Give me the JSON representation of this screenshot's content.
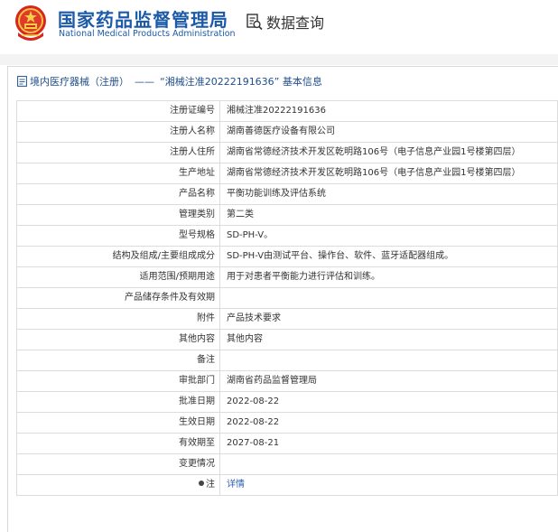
{
  "header": {
    "agency_cn": "国家药品监督管理局",
    "agency_en": "National Medical Products Administration",
    "query_label": "数据查询",
    "emblem_icon": "national-emblem-icon",
    "query_icon": "data-query-icon",
    "brand_color": "#1c5aa8"
  },
  "breadcrumb": {
    "section": "境内医疗器械（注册）",
    "separator": "——",
    "title": "“湘械注准20222191636” 基本信息"
  },
  "fields": [
    {
      "label": "注册证编号",
      "value": "湘械注准20222191636"
    },
    {
      "label": "注册人名称",
      "value": "湖南善德医疗设备有限公司"
    },
    {
      "label": "注册人住所",
      "value": "湖南省常德经济技术开发区乾明路106号（电子信息产业园1号楼第四层）"
    },
    {
      "label": "生产地址",
      "value": "湖南省常德经济技术开发区乾明路106号（电子信息产业园1号楼第四层）"
    },
    {
      "label": "产品名称",
      "value": "平衡功能训练及评估系统"
    },
    {
      "label": "管理类别",
      "value": "第二类"
    },
    {
      "label": "型号规格",
      "value": "SD-PH-V。"
    },
    {
      "label": "结构及组成/主要组成成分",
      "value": "SD-PH-V由测试平台、操作台、软件、蓝牙适配器组成。"
    },
    {
      "label": "适用范围/预期用途",
      "value": "用于对患者平衡能力进行评估和训练。"
    },
    {
      "label": "产品储存条件及有效期",
      "value": ""
    },
    {
      "label": "附件",
      "value": "产品技术要求"
    },
    {
      "label": "其他内容",
      "value": "其他内容"
    },
    {
      "label": "备注",
      "value": ""
    },
    {
      "label": "审批部门",
      "value": "湖南省药品监督管理局"
    },
    {
      "label": "批准日期",
      "value": "2022-08-22"
    },
    {
      "label": "生效日期",
      "value": "2022-08-22"
    },
    {
      "label": "有效期至",
      "value": "2027-08-21"
    },
    {
      "label": "变更情况",
      "value": ""
    }
  ],
  "note_row": {
    "label": "注",
    "link_text": "详情",
    "icon": "pin-icon"
  }
}
